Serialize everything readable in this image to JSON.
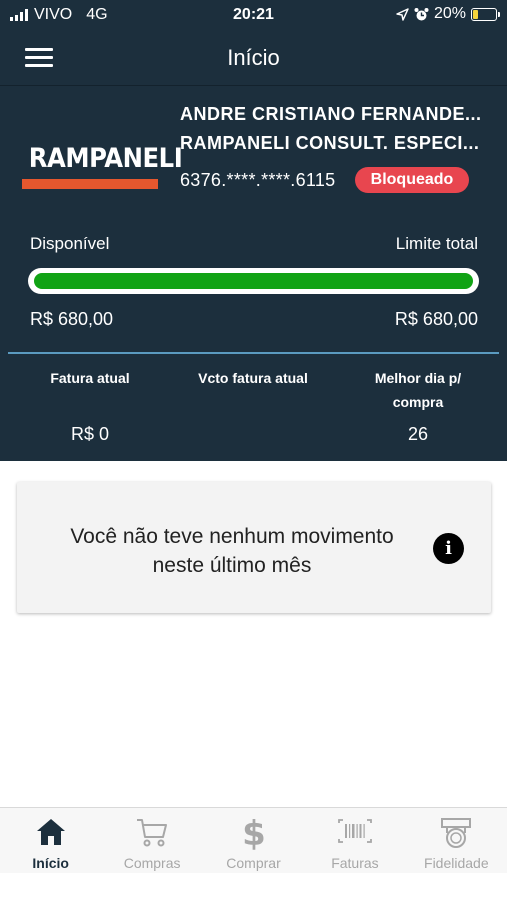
{
  "status_bar": {
    "carrier": "VIVO",
    "network": "4G",
    "time": "20:21",
    "battery": "20%",
    "icons": [
      "signal-icon",
      "location-arrow-icon",
      "alarm-clock-icon",
      "battery-charging-icon"
    ]
  },
  "app_bar": {
    "title": "Início",
    "menu_icon": "hamburger-menu-icon"
  },
  "card": {
    "logo_text": "RAMPANELI",
    "holder_name": "ANDRE CRISTIANO FERNANDE...",
    "company": "RAMPANELI CONSULT. ESPECI...",
    "number": "6376.****.****.6115",
    "status": "Bloqueado",
    "status_color": "#e8464f"
  },
  "limits": {
    "available_label": "Disponível",
    "total_label": "Limite total",
    "available_value": "R$ 680,00",
    "total_value": "R$ 680,00",
    "available_fraction": 1.0,
    "bar_color": "#11a315"
  },
  "summary": {
    "current_invoice_label": "Fatura atual",
    "due_date_label": "Vcto fatura atual",
    "best_day_label": "Melhor dia p/ compra",
    "current_invoice_value": "R$ 0",
    "due_date_value": "",
    "best_day_value": "26"
  },
  "notice": {
    "message": "Você não teve nenhum movimento neste último mês",
    "icon": "info-icon"
  },
  "tabs": [
    {
      "label": "Início",
      "icon": "home-icon",
      "active": true
    },
    {
      "label": "Compras",
      "icon": "shopping-cart-icon",
      "active": false
    },
    {
      "label": "Comprar",
      "icon": "dollar-icon",
      "active": false
    },
    {
      "label": "Faturas",
      "icon": "barcode-icon",
      "active": false
    },
    {
      "label": "Fidelidade",
      "icon": "loyalty-badge-icon",
      "active": false
    }
  ],
  "colors": {
    "header_bg": "#1c2f3d",
    "accent": "#e4572e",
    "divider": "#5b9bc0",
    "tab_active": "#1c2f3d",
    "tab_inactive": "#a7a7a7"
  }
}
